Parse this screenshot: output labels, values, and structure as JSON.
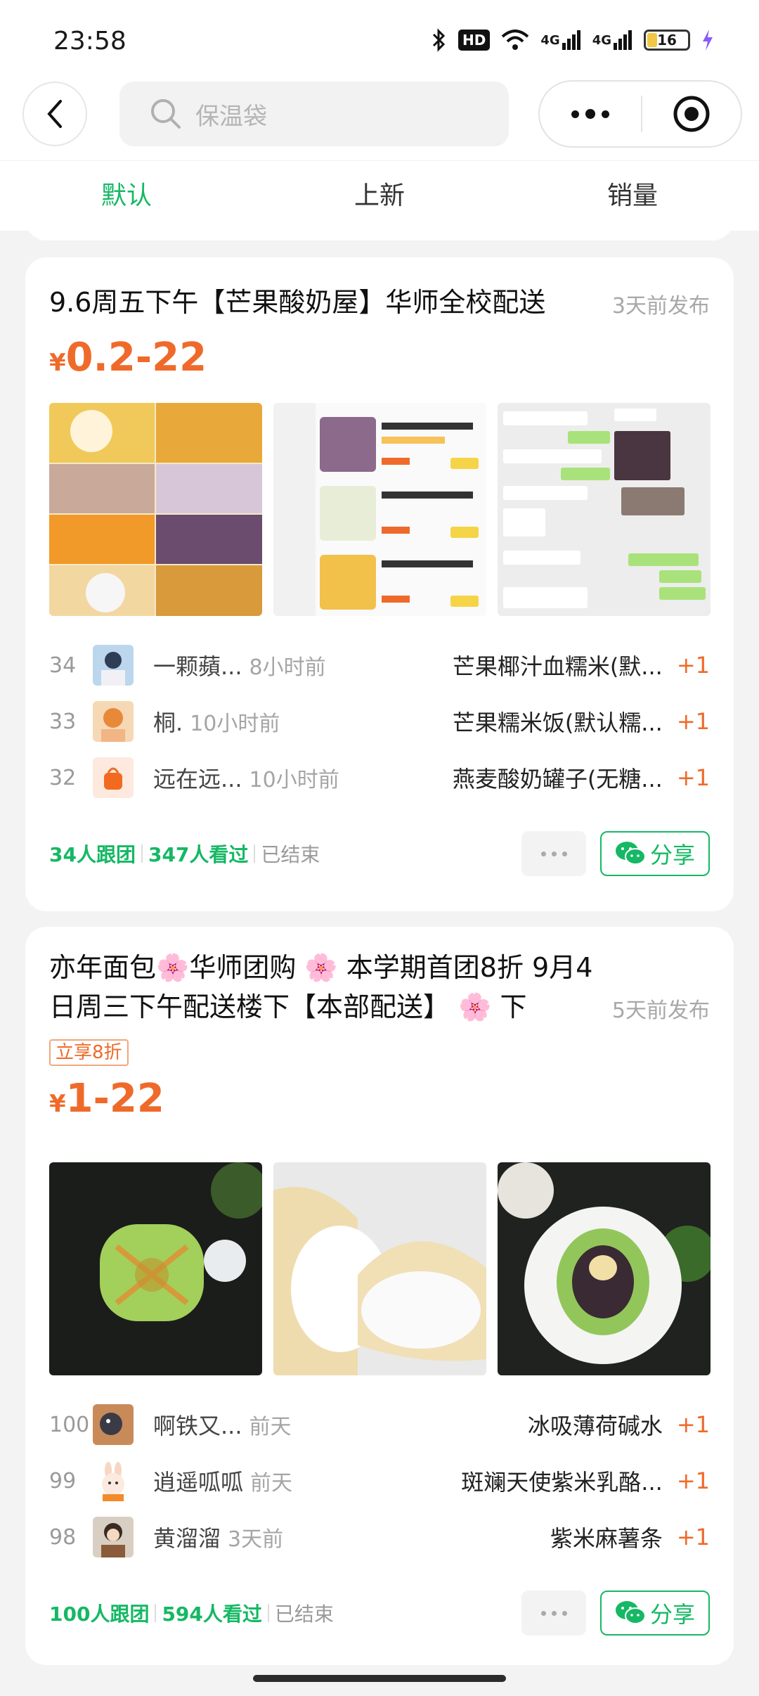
{
  "status_bar": {
    "time": "23:58",
    "hd": "HD",
    "net1": "4G",
    "net2": "4G",
    "battery": "16"
  },
  "search": {
    "placeholder": "保温袋"
  },
  "tabs": [
    {
      "label": "默认",
      "active": true
    },
    {
      "label": "上新",
      "active": false
    },
    {
      "label": "销量",
      "active": false
    }
  ],
  "cards": [
    {
      "title": "9.6周五下午【芒果酸奶屋】华师全校配送",
      "posted": "3天前发布",
      "price_symbol": "¥",
      "price": "0.2-22",
      "orders": [
        {
          "rank": "34",
          "user": "一颗蘋...",
          "time": "8小时前",
          "item": "芒果椰汁血糯米(默...",
          "qty": "+1"
        },
        {
          "rank": "33",
          "user": "桐.",
          "time": "10小时前",
          "item": "芒果糯米饭(默认糯...",
          "qty": "+1"
        },
        {
          "rank": "32",
          "user": "远在远...",
          "time": "10小时前",
          "item": "燕麦酸奶罐子(无糖...",
          "qty": "+1"
        }
      ],
      "joined": "34人跟团",
      "viewed": "347人看过",
      "status": "已结束",
      "share_label": "分享"
    },
    {
      "title": "亦年面包🌸华师团购 🌸 本学期首团8折 9月4日周三下午配送楼下【本部配送】 🌸 下",
      "posted": "5天前发布",
      "discount_tag": "立享8折",
      "price_symbol": "¥",
      "price": "1-22",
      "orders": [
        {
          "rank": "100",
          "user": "啊铁又...",
          "time": "前天",
          "item": "冰吸薄荷碱水",
          "qty": "+1"
        },
        {
          "rank": "99",
          "user": "逍遥呱呱",
          "time": "前天",
          "item": "斑斓天使紫米乳酪...",
          "qty": "+1"
        },
        {
          "rank": "98",
          "user": "黄溜溜",
          "time": "3天前",
          "item": "紫米麻薯条",
          "qty": "+1"
        }
      ],
      "joined": "100人跟团",
      "viewed": "594人看过",
      "status": "已结束",
      "share_label": "分享"
    }
  ],
  "colors": {
    "accent_green": "#15b864",
    "price_orange": "#ef6a2a"
  }
}
